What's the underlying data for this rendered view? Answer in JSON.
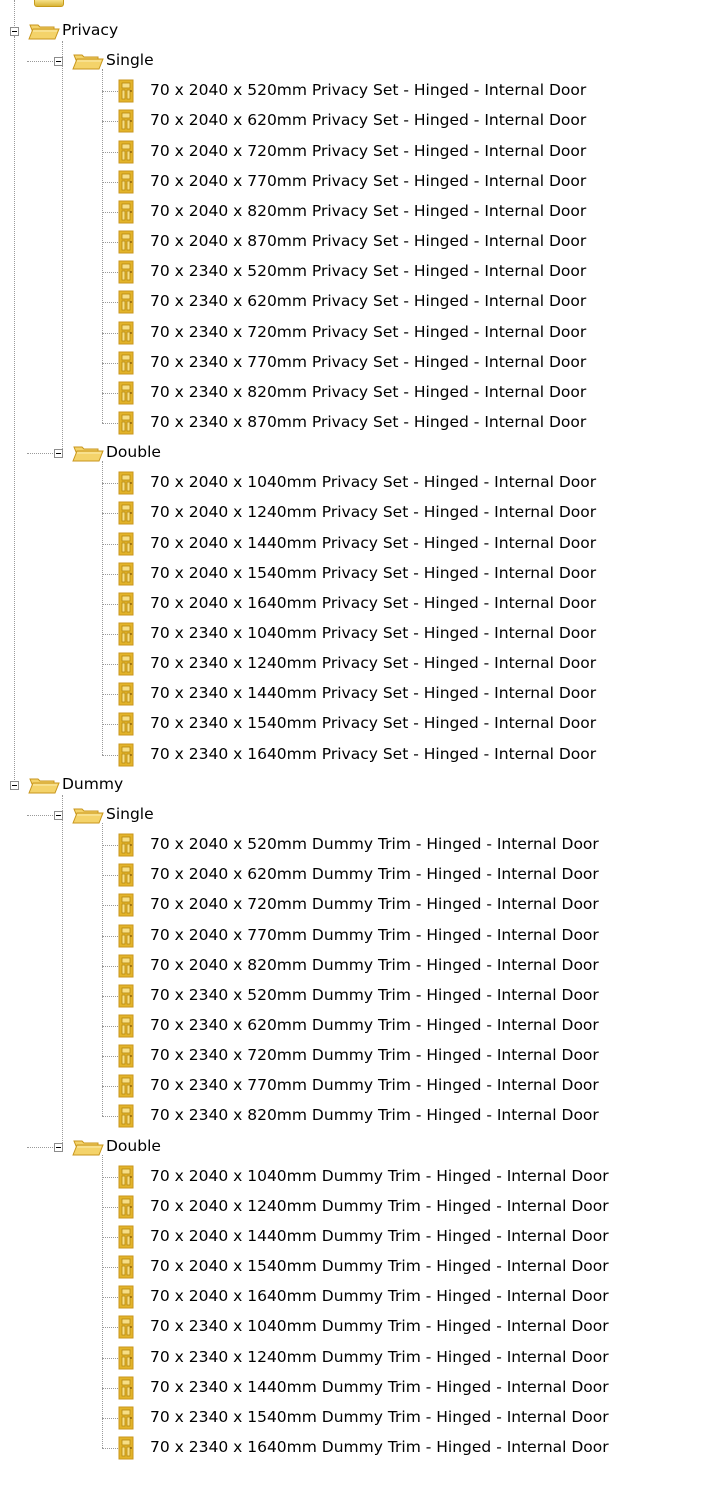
{
  "tree": [
    {
      "label": "Privacy",
      "children": [
        {
          "label": "Single",
          "items": [
            "70 x 2040 x 520mm Privacy Set - Hinged - Internal Door",
            "70 x 2040 x 620mm Privacy Set - Hinged - Internal Door",
            "70 x 2040 x 720mm Privacy Set - Hinged - Internal Door",
            "70 x 2040 x 770mm Privacy Set - Hinged - Internal Door",
            "70 x 2040 x 820mm Privacy Set - Hinged - Internal Door",
            "70 x 2040 x 870mm Privacy Set - Hinged - Internal Door",
            "70 x 2340 x 520mm Privacy Set - Hinged - Internal Door",
            "70 x 2340 x 620mm Privacy Set - Hinged - Internal Door",
            "70 x 2340 x 720mm Privacy Set - Hinged - Internal Door",
            "70 x 2340 x 770mm Privacy Set - Hinged - Internal Door",
            "70 x 2340 x 820mm Privacy Set - Hinged - Internal Door",
            "70 x 2340 x 870mm Privacy Set - Hinged - Internal Door"
          ]
        },
        {
          "label": "Double",
          "items": [
            "70 x 2040 x 1040mm Privacy Set - Hinged - Internal Door",
            "70 x 2040 x 1240mm Privacy Set - Hinged - Internal Door",
            "70 x 2040 x 1440mm Privacy Set - Hinged - Internal Door",
            "70 x 2040 x 1540mm Privacy Set - Hinged - Internal Door",
            "70 x 2040 x 1640mm Privacy Set - Hinged - Internal Door",
            "70 x 2340 x 1040mm Privacy Set - Hinged - Internal Door",
            "70 x 2340 x 1240mm Privacy Set - Hinged - Internal Door",
            "70 x 2340 x 1440mm Privacy Set - Hinged - Internal Door",
            "70 x 2340 x 1540mm Privacy Set - Hinged - Internal Door",
            "70 x 2340 x 1640mm Privacy Set - Hinged - Internal Door"
          ]
        }
      ]
    },
    {
      "label": "Dummy",
      "children": [
        {
          "label": "Single",
          "items": [
            "70 x 2040 x 520mm Dummy Trim - Hinged - Internal Door",
            "70 x 2040 x 620mm Dummy Trim - Hinged - Internal Door",
            "70 x 2040 x 720mm Dummy Trim - Hinged - Internal Door",
            "70 x 2040 x 770mm Dummy Trim - Hinged - Internal Door",
            "70 x 2040 x 820mm Dummy Trim - Hinged - Internal Door",
            "70 x 2340 x 520mm Dummy Trim - Hinged - Internal Door",
            "70 x 2340 x 620mm Dummy Trim - Hinged - Internal Door",
            "70 x 2340 x 720mm Dummy Trim - Hinged - Internal Door",
            "70 x 2340 x 770mm Dummy Trim - Hinged - Internal Door",
            "70 x 2340 x 820mm Dummy Trim - Hinged - Internal Door"
          ]
        },
        {
          "label": "Double",
          "items": [
            "70 x 2040 x 1040mm Dummy Trim - Hinged - Internal Door",
            "70 x 2040 x 1240mm Dummy Trim - Hinged - Internal Door",
            "70 x 2040 x 1440mm Dummy Trim - Hinged - Internal Door",
            "70 x 2040 x 1540mm Dummy Trim - Hinged - Internal Door",
            "70 x 2040 x 1640mm Dummy Trim - Hinged - Internal Door",
            "70 x 2340 x 1040mm Dummy Trim - Hinged - Internal Door",
            "70 x 2340 x 1240mm Dummy Trim - Hinged - Internal Door",
            "70 x 2340 x 1440mm Dummy Trim - Hinged - Internal Door",
            "70 x 2340 x 1540mm Dummy Trim - Hinged - Internal Door",
            "70 x 2340 x 1640mm Dummy Trim - Hinged - Internal Door"
          ]
        }
      ]
    }
  ],
  "colors": {
    "folder_fill": "#f4d36a",
    "folder_dark": "#c8961c",
    "connector": "#9a9a9a",
    "door_fill": "#e3b42a"
  },
  "icons": {
    "folder": "folder-open-icon",
    "item": "door-icon",
    "expander": "collapse-minus-icon"
  }
}
